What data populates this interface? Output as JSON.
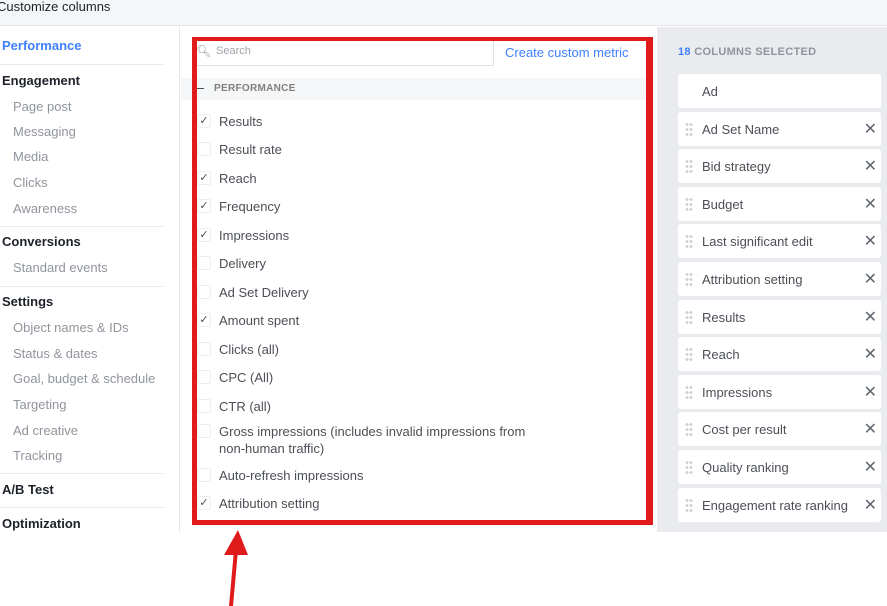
{
  "header": {
    "title": "Customize columns"
  },
  "sidebar": {
    "items": [
      {
        "label": "Performance",
        "kind": "active"
      },
      {
        "label": "Engagement",
        "kind": "section"
      },
      {
        "label": "Page post",
        "kind": "sub"
      },
      {
        "label": "Messaging",
        "kind": "sub"
      },
      {
        "label": "Media",
        "kind": "sub"
      },
      {
        "label": "Clicks",
        "kind": "sub"
      },
      {
        "label": "Awareness",
        "kind": "sub"
      },
      {
        "label": "Conversions",
        "kind": "section"
      },
      {
        "label": "Standard events",
        "kind": "sub"
      },
      {
        "label": "Settings",
        "kind": "section"
      },
      {
        "label": "Object names & IDs",
        "kind": "sub"
      },
      {
        "label": "Status & dates",
        "kind": "sub"
      },
      {
        "label": "Goal, budget & schedule",
        "kind": "sub"
      },
      {
        "label": "Targeting",
        "kind": "sub"
      },
      {
        "label": "Ad creative",
        "kind": "sub"
      },
      {
        "label": "Tracking",
        "kind": "sub"
      },
      {
        "label": "A/B Test",
        "kind": "section"
      },
      {
        "label": "Optimization",
        "kind": "section"
      }
    ]
  },
  "main": {
    "search": {
      "placeholder": "Search",
      "icon": "search-icon"
    },
    "create_custom_metric": "Create custom metric",
    "group_label": "PERFORMANCE",
    "metrics": [
      {
        "label": "Results",
        "checked": true
      },
      {
        "label": "Result rate",
        "checked": false
      },
      {
        "label": "Reach",
        "checked": true
      },
      {
        "label": "Frequency",
        "checked": true
      },
      {
        "label": "Impressions",
        "checked": true
      },
      {
        "label": "Delivery",
        "checked": false
      },
      {
        "label": "Ad Set Delivery",
        "checked": false
      },
      {
        "label": "Amount spent",
        "checked": true
      },
      {
        "label": "Clicks (all)",
        "checked": false
      },
      {
        "label": "CPC (All)",
        "checked": false
      },
      {
        "label": "CTR (all)",
        "checked": false
      },
      {
        "label": "Gross impressions (includes invalid impressions from",
        "label2": "non-human traffic)",
        "checked": false
      },
      {
        "label": "Auto-refresh impressions",
        "checked": false
      },
      {
        "label": "Attribution setting",
        "checked": true
      }
    ]
  },
  "selected": {
    "count": "18",
    "label": "COLUMNS SELECTED",
    "columns": [
      "Ad",
      "Ad Set Name",
      "Bid strategy",
      "Budget",
      "Last significant edit",
      "Attribution setting",
      "Results",
      "Reach",
      "Impressions",
      "Cost per result",
      "Quality ranking",
      "Engagement rate ranking"
    ]
  },
  "annotation": {
    "color": "#e01b1b"
  },
  "colors": {
    "accent": "#4080ff"
  }
}
